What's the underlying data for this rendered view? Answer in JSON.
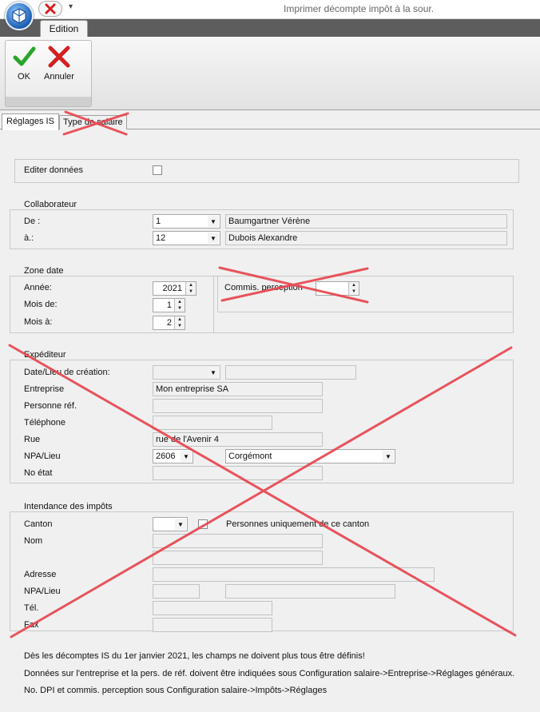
{
  "window": {
    "title": "Imprimer décompte impôt à la sour.",
    "qat_arrow": "▾",
    "qat_icon": "close-icon"
  },
  "ribbon": {
    "tab": "Edition",
    "ok_label": "OK",
    "cancel_label": "Annuler"
  },
  "tabs": [
    {
      "label": "Réglages IS"
    },
    {
      "label": "Type de salaire"
    }
  ],
  "edit_data": {
    "label": "Editer données",
    "checked": false
  },
  "collaborateur": {
    "title": "Collaborateur",
    "from_label": "De :",
    "from_value": "1",
    "from_name": "Baumgartner Vérène",
    "to_label": "à.:",
    "to_value": "12",
    "to_name": "Dubois Alexandre"
  },
  "zone_date": {
    "title": "Zone date",
    "year_label": "Année:",
    "year_value": "2021",
    "month_from_label": "Mois de:",
    "month_from_value": "1",
    "month_to_label": "Mois à:",
    "month_to_value": "2",
    "commission_label": "Commis. perception"
  },
  "expediteur": {
    "title": "Expéditeur",
    "date_label": "Date/Lieu de création:",
    "company_label": "Entreprise",
    "company_value": "Mon entreprise SA",
    "contact_label": "Personne réf.",
    "phone_label": "Téléphone",
    "street_label": "Rue",
    "street_value": "rue de l'Avenir 4",
    "zip_label": "NPA/Lieu",
    "zip_value": "2606",
    "city_value": "Corgémont",
    "state_no_label": "No état"
  },
  "intendance": {
    "title": "Intendance des impôts",
    "canton_label": "Canton",
    "canton_only_label": "Personnes uniquement de ce canton",
    "name_label": "Nom",
    "address_label": "Adresse",
    "zip_label": "NPA/Lieu",
    "tel_label": "Tél.",
    "fax_label": "Fax"
  },
  "notes": [
    "Dès les décomptes IS du 1er janvier 2021, les champs ne doivent plus tous être définis!",
    "Données sur l'entreprise et la pers. de réf. doivent être indiquées sous Configuration salaire->Entreprise->Réglages généraux.",
    "No. DPI et commis. perception sous Configuration salaire->Impôts->Réglages"
  ],
  "colors": {
    "cross_mark": "#e8464f",
    "ok_check": "#2aa52a",
    "cancel_x": "#d42020"
  }
}
